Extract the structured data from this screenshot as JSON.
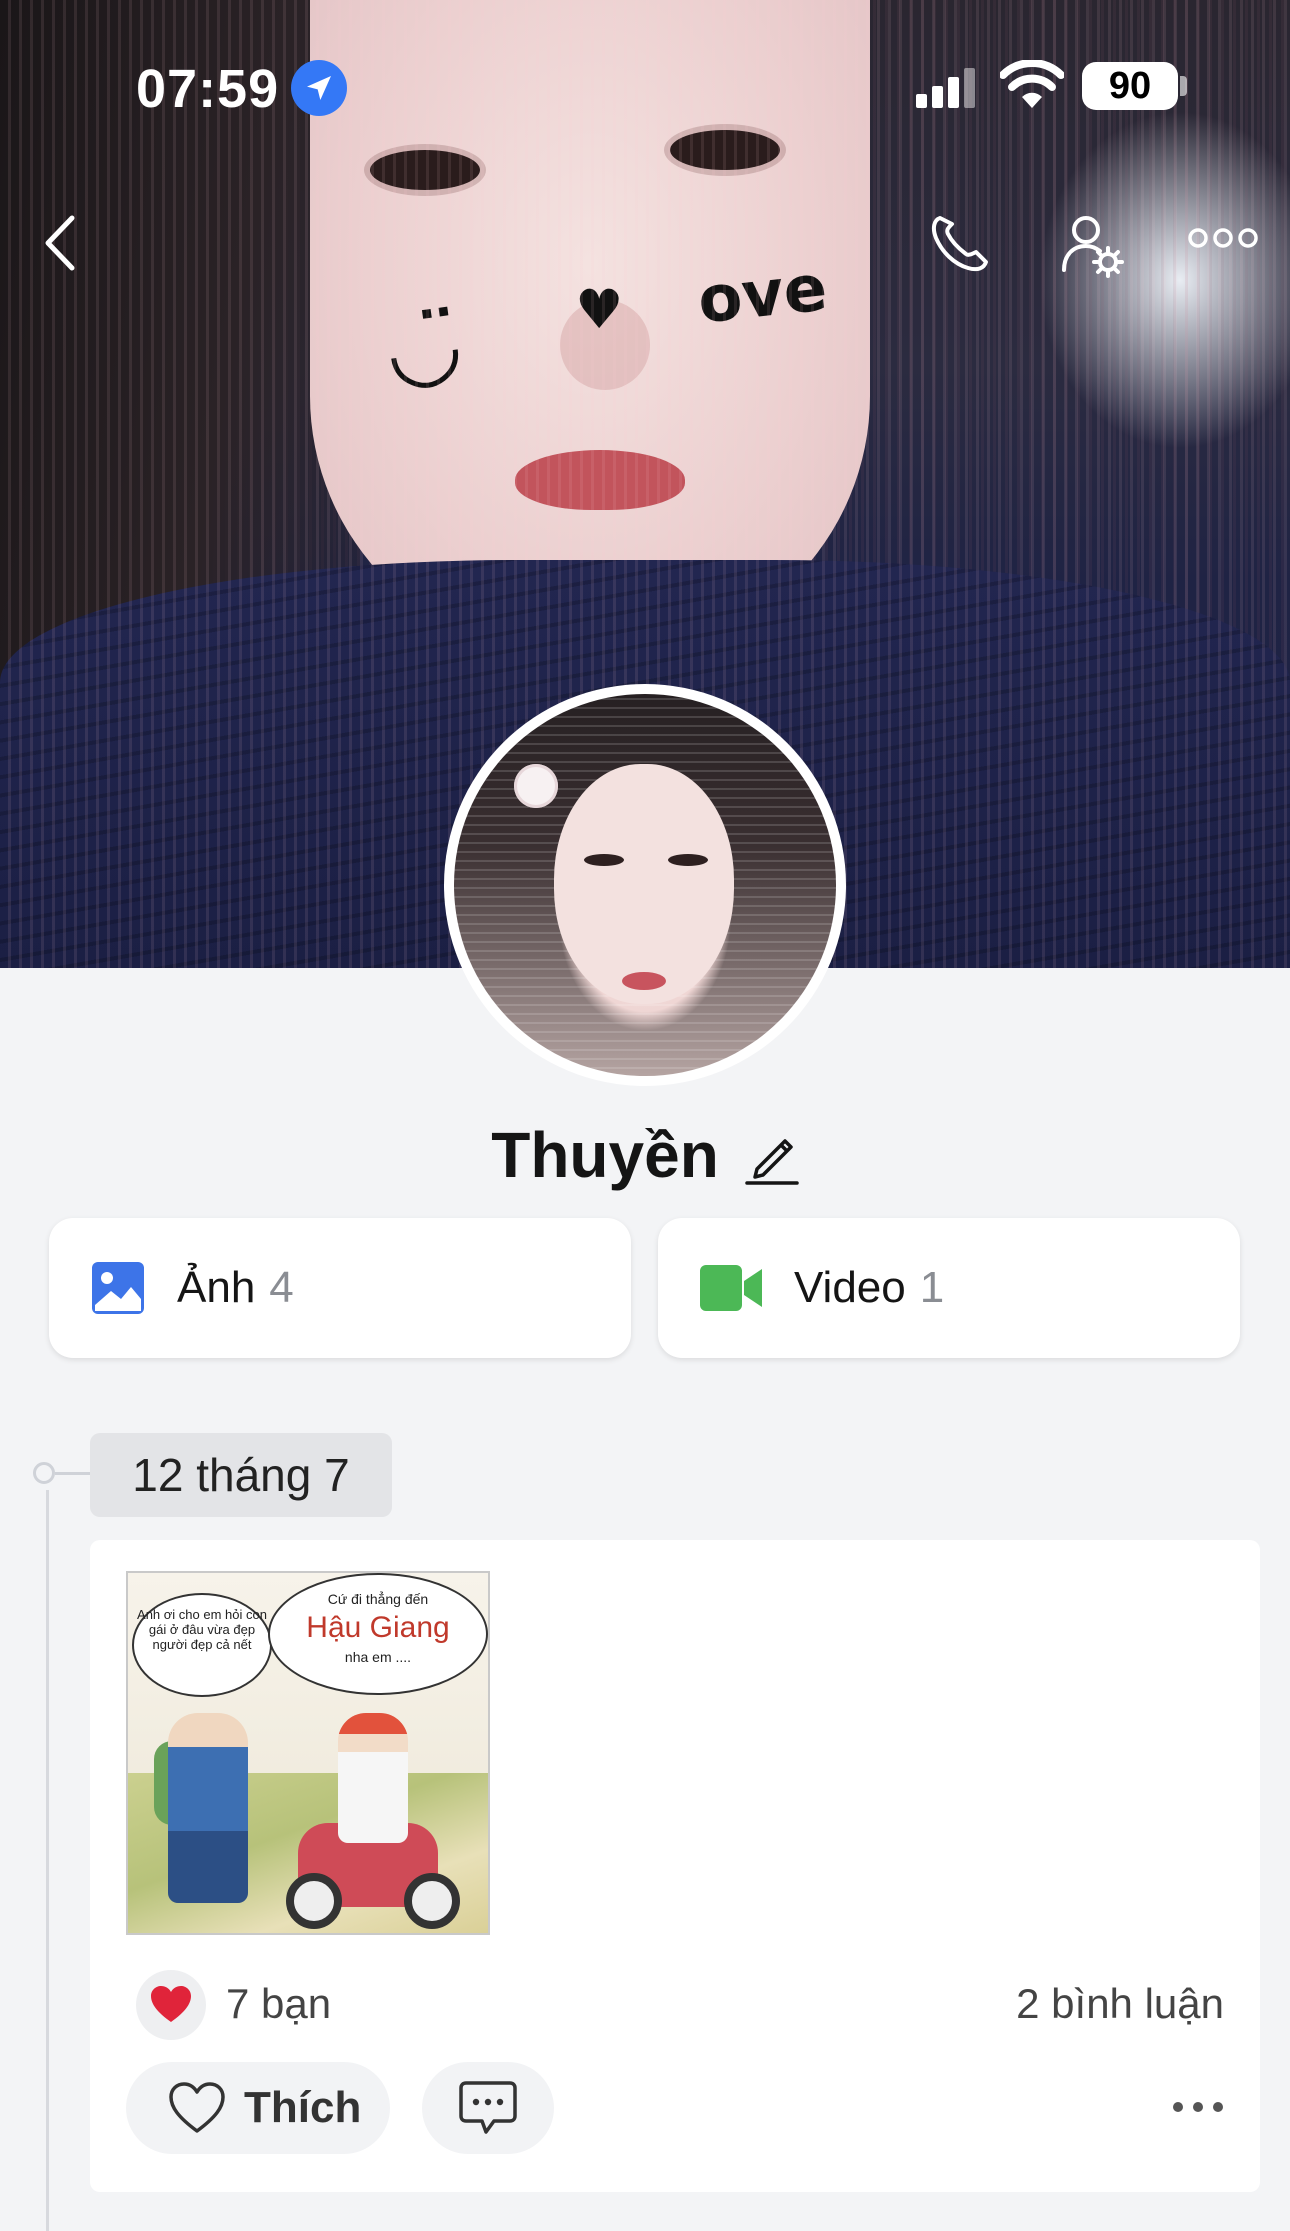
{
  "status_bar": {
    "time": "07:59",
    "battery": "90",
    "icons": [
      "location-arrow-icon",
      "cellular-signal-icon",
      "wifi-icon",
      "battery-icon"
    ]
  },
  "nav": {
    "icons": [
      "back-chevron-icon",
      "phone-icon",
      "profile-settings-icon",
      "more-dots-icon"
    ]
  },
  "profile": {
    "name": "Thuyền",
    "edit_icon": "pencil-icon"
  },
  "media": [
    {
      "label": "Ảnh",
      "count": "4",
      "icon": "photo-icon",
      "color": "#3d74e8"
    },
    {
      "label": "Video",
      "count": "1",
      "icon": "video-camera-icon",
      "color": "#4cb856"
    }
  ],
  "timeline": {
    "date": "12 tháng 7"
  },
  "post": {
    "image": {
      "bubble_left": "Anh ơi cho em hỏi con gái ở đâu vừa đẹp người đẹp cả nết",
      "bubble_right_top": "Cứ đi thẳng đến",
      "bubble_right_big": "Hậu Giang",
      "bubble_right_bottom": "nha em ...."
    },
    "reactions": "7 bạn",
    "comments": "2 bình luận",
    "like_label": "Thích",
    "heart_color": "#e0243a"
  }
}
